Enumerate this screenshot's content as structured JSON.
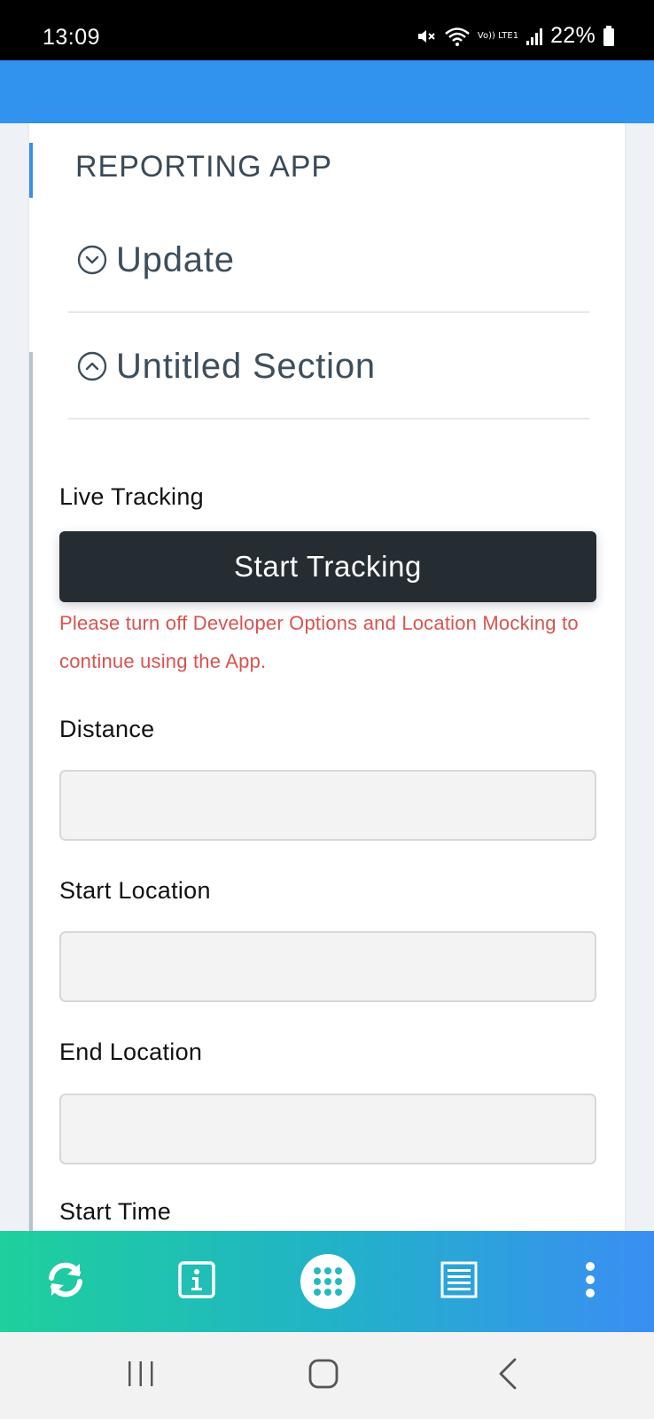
{
  "status_bar": {
    "time": "13:09",
    "network_label": "Vo)) LTE1",
    "battery": "22%",
    "icons": [
      "mute-icon",
      "wifi-icon",
      "volte-icon",
      "signal-icon",
      "battery-icon"
    ]
  },
  "header": {
    "color": "#3293ee"
  },
  "card": {
    "title": "REPORTING APP",
    "sections": [
      {
        "label": "Update",
        "state": "collapsed",
        "icon": "chevron-down-circle-icon"
      },
      {
        "label": "Untitled Section",
        "state": "expanded",
        "icon": "chevron-up-circle-icon"
      }
    ]
  },
  "form": {
    "live_tracking_label": "Live Tracking",
    "start_button_label": "Start Tracking",
    "warning": "Please turn off Developer Options and Location Mocking to continue using the App.",
    "fields": {
      "distance": {
        "label": "Distance",
        "value": ""
      },
      "start_location": {
        "label": "Start Location",
        "value": ""
      },
      "end_location": {
        "label": "End Location",
        "value": ""
      },
      "start_time": {
        "label": "Start Time"
      }
    }
  },
  "toolbar": {
    "buttons": [
      "sync-icon",
      "info-icon",
      "apps-grid-icon",
      "list-icon",
      "more-vertical-icon"
    ],
    "gradient": [
      "#1ed09b",
      "#21b3c7",
      "#3a8ef3"
    ]
  },
  "navbar": {
    "buttons": [
      "recent-apps-icon",
      "home-icon",
      "back-icon"
    ]
  },
  "colors": {
    "accent": "#3a8ee6",
    "button_dark": "#252d33",
    "warning_text": "#d9534f"
  }
}
